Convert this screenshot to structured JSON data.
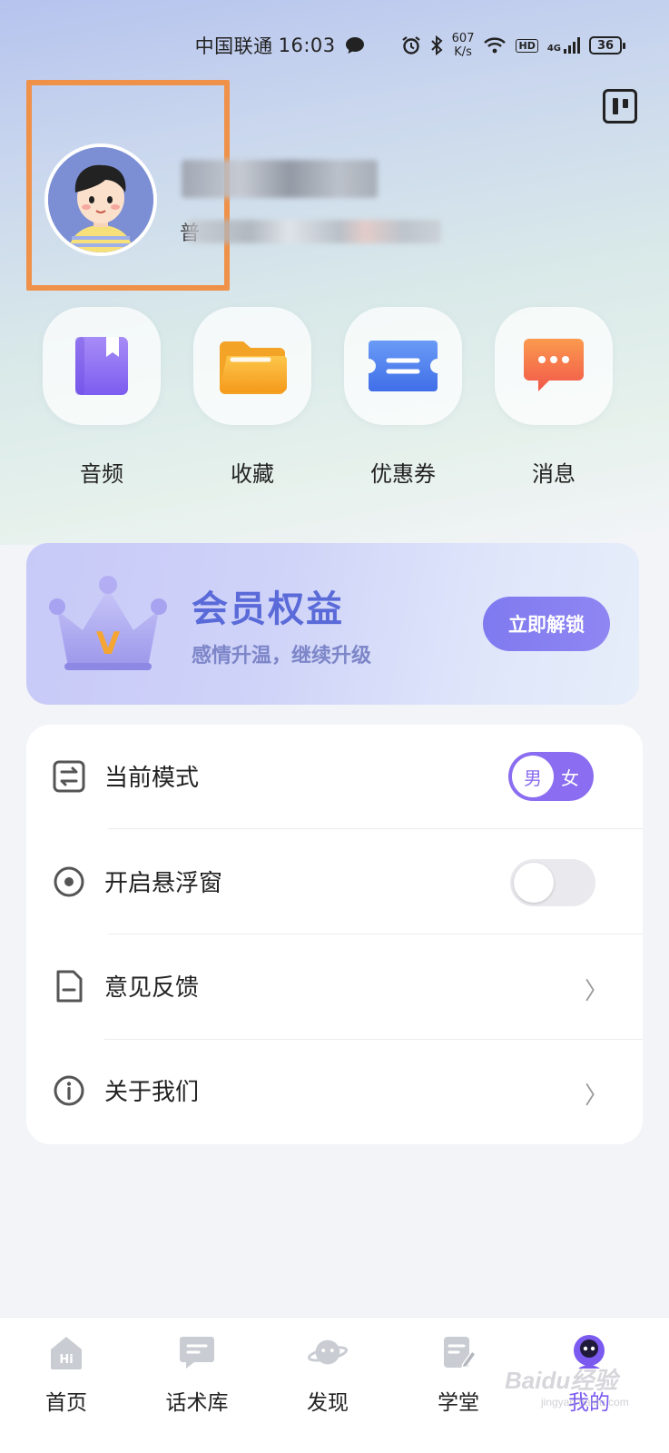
{
  "status_bar": {
    "carrier": "中国联通",
    "time": "16:03",
    "net_speed_value": "607",
    "net_speed_unit": "K/s",
    "hd_label": "HD",
    "network_label": "4G",
    "battery": "36",
    "icons": [
      "message-icon",
      "alarm-icon",
      "bluetooth-icon",
      "wifi-icon",
      "signal-icon"
    ]
  },
  "profile": {
    "username": "",
    "subinfo_prefix": "普"
  },
  "quick_actions": [
    {
      "label": "音频",
      "icon": "audio-book-icon",
      "color": "#8a6bf2"
    },
    {
      "label": "收藏",
      "icon": "folder-icon",
      "color": "#f7a52c"
    },
    {
      "label": "优惠券",
      "icon": "coupon-icon",
      "color": "#4f7ff0"
    },
    {
      "label": "消息",
      "icon": "chat-bubble-icon",
      "color": "#f5704f"
    }
  ],
  "vip": {
    "title": "会员权益",
    "subtitle": "感情升温，继续升级",
    "button": "立即解锁",
    "badge_letter": "V"
  },
  "settings": [
    {
      "label": "当前模式",
      "icon": "mode-switch-icon",
      "control": "gender-toggle"
    },
    {
      "label": "开启悬浮窗",
      "icon": "floating-window-icon",
      "control": "switch"
    },
    {
      "label": "意见反馈",
      "icon": "feedback-document-icon",
      "control": "chevron"
    },
    {
      "label": "关于我们",
      "icon": "info-icon",
      "control": "chevron"
    }
  ],
  "gender_toggle": {
    "selected": "男",
    "other": "女"
  },
  "chevron": "〉",
  "tabs": [
    {
      "label": "首页",
      "icon": "home-hi-icon",
      "icon_text": "Hi"
    },
    {
      "label": "话术库",
      "icon": "chat-library-icon"
    },
    {
      "label": "发现",
      "icon": "planet-icon"
    },
    {
      "label": "学堂",
      "icon": "study-notebook-icon"
    },
    {
      "label": "我的",
      "icon": "profile-avatar-icon",
      "active": true
    }
  ],
  "watermark": {
    "brand": "Baidu经验",
    "url": "jingyan.baidu.com"
  },
  "colors": {
    "accent": "#7b5af0",
    "highlight_frame": "#ef9148",
    "vip_title": "#5a6ad8"
  }
}
